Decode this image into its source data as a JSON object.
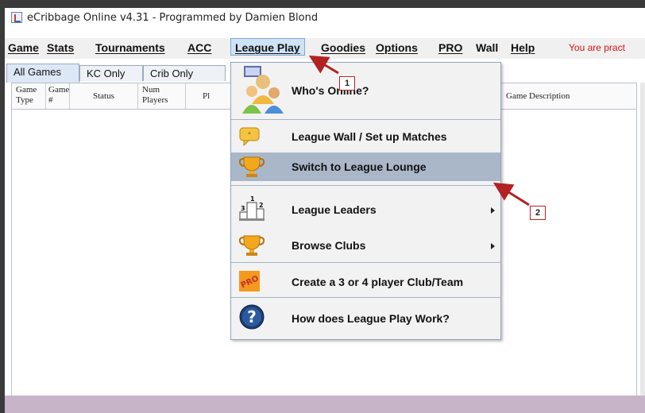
{
  "window": {
    "title": "eCribbage Online v4.31 - Programmed by Damien Blond"
  },
  "menubar": {
    "items": [
      {
        "label": "Game"
      },
      {
        "label": "Stats"
      },
      {
        "label": "Tournaments"
      },
      {
        "label": "ACC"
      },
      {
        "label": "League Play"
      },
      {
        "label": "Goodies"
      },
      {
        "label": "Options"
      },
      {
        "label": "PRO"
      },
      {
        "label": "Wall"
      },
      {
        "label": "Help"
      }
    ],
    "status_text": "You are pract"
  },
  "tabs": [
    {
      "label": "All Games"
    },
    {
      "label": "KC Only"
    },
    {
      "label": "Crib Only"
    }
  ],
  "table": {
    "headers": {
      "game_type": "Game Type",
      "game_num": "Game #",
      "status": "Status",
      "num_players": "Num Players",
      "players_partial": "Pl",
      "game_description": "Game Description"
    }
  },
  "dropdown": {
    "items": [
      {
        "label": "Who's Online?",
        "icon": "users-online-icon"
      },
      {
        "label": "League Wall / Set up Matches",
        "icon": "speech-bubble-icon"
      },
      {
        "label": "Switch to League Lounge",
        "icon": "trophy-icon"
      },
      {
        "label": "League Leaders",
        "icon": "podium-icon"
      },
      {
        "label": "Browse Clubs",
        "icon": "trophy-icon"
      },
      {
        "label": "Create a 3 or 4 player Club/Team",
        "icon": "pro-icon"
      },
      {
        "label": "How does League Play Work?",
        "icon": "help-icon"
      }
    ],
    "highlighted": "Switch to League Lounge"
  },
  "annotations": {
    "callout_1": "1",
    "callout_2": "2"
  },
  "colors": {
    "menu_highlight": "#a9b7c9",
    "status_text": "#dd1111",
    "annotation_arrow": "#b22222"
  }
}
